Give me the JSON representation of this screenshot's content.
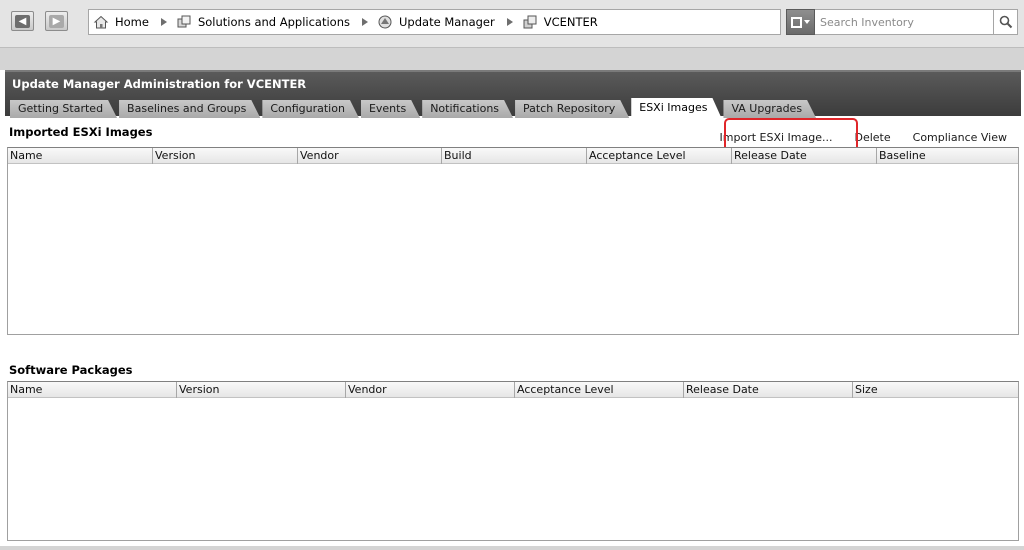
{
  "toolbar": {
    "back": "back-arrow",
    "forward": "forward-arrow",
    "breadcrumb": [
      {
        "label": "Home",
        "icon": "home-icon"
      },
      {
        "label": "Solutions and Applications",
        "icon": "solutions-icon"
      },
      {
        "label": "Update Manager",
        "icon": "update-manager-icon"
      },
      {
        "label": "VCENTER",
        "icon": "vcenter-icon"
      }
    ],
    "search": {
      "placeholder": "Search Inventory",
      "value": ""
    }
  },
  "panel": {
    "title": "Update Manager Administration for VCENTER",
    "tabs": [
      {
        "label": "Getting Started"
      },
      {
        "label": "Baselines and Groups"
      },
      {
        "label": "Configuration"
      },
      {
        "label": "Events"
      },
      {
        "label": "Notifications"
      },
      {
        "label": "Patch Repository"
      },
      {
        "label": "ESXi Images",
        "active": true
      },
      {
        "label": "VA Upgrades"
      }
    ]
  },
  "images_section": {
    "title": "Imported ESXi Images",
    "actions": {
      "import": "Import ESXi Image...",
      "delete": "Delete",
      "compliance": "Compliance View"
    },
    "columns": [
      "Name",
      "Version",
      "Vendor",
      "Build",
      "Acceptance Level",
      "Release Date",
      "Baseline"
    ],
    "rows": []
  },
  "packages_section": {
    "title": "Software Packages",
    "columns": [
      "Name",
      "Version",
      "Vendor",
      "Acceptance Level",
      "Release Date",
      "Size"
    ],
    "rows": []
  },
  "colors": {
    "highlight": "#e0262a",
    "panel_header": "#4a4a4a",
    "toolbar_bg": "#e4e4e4"
  }
}
